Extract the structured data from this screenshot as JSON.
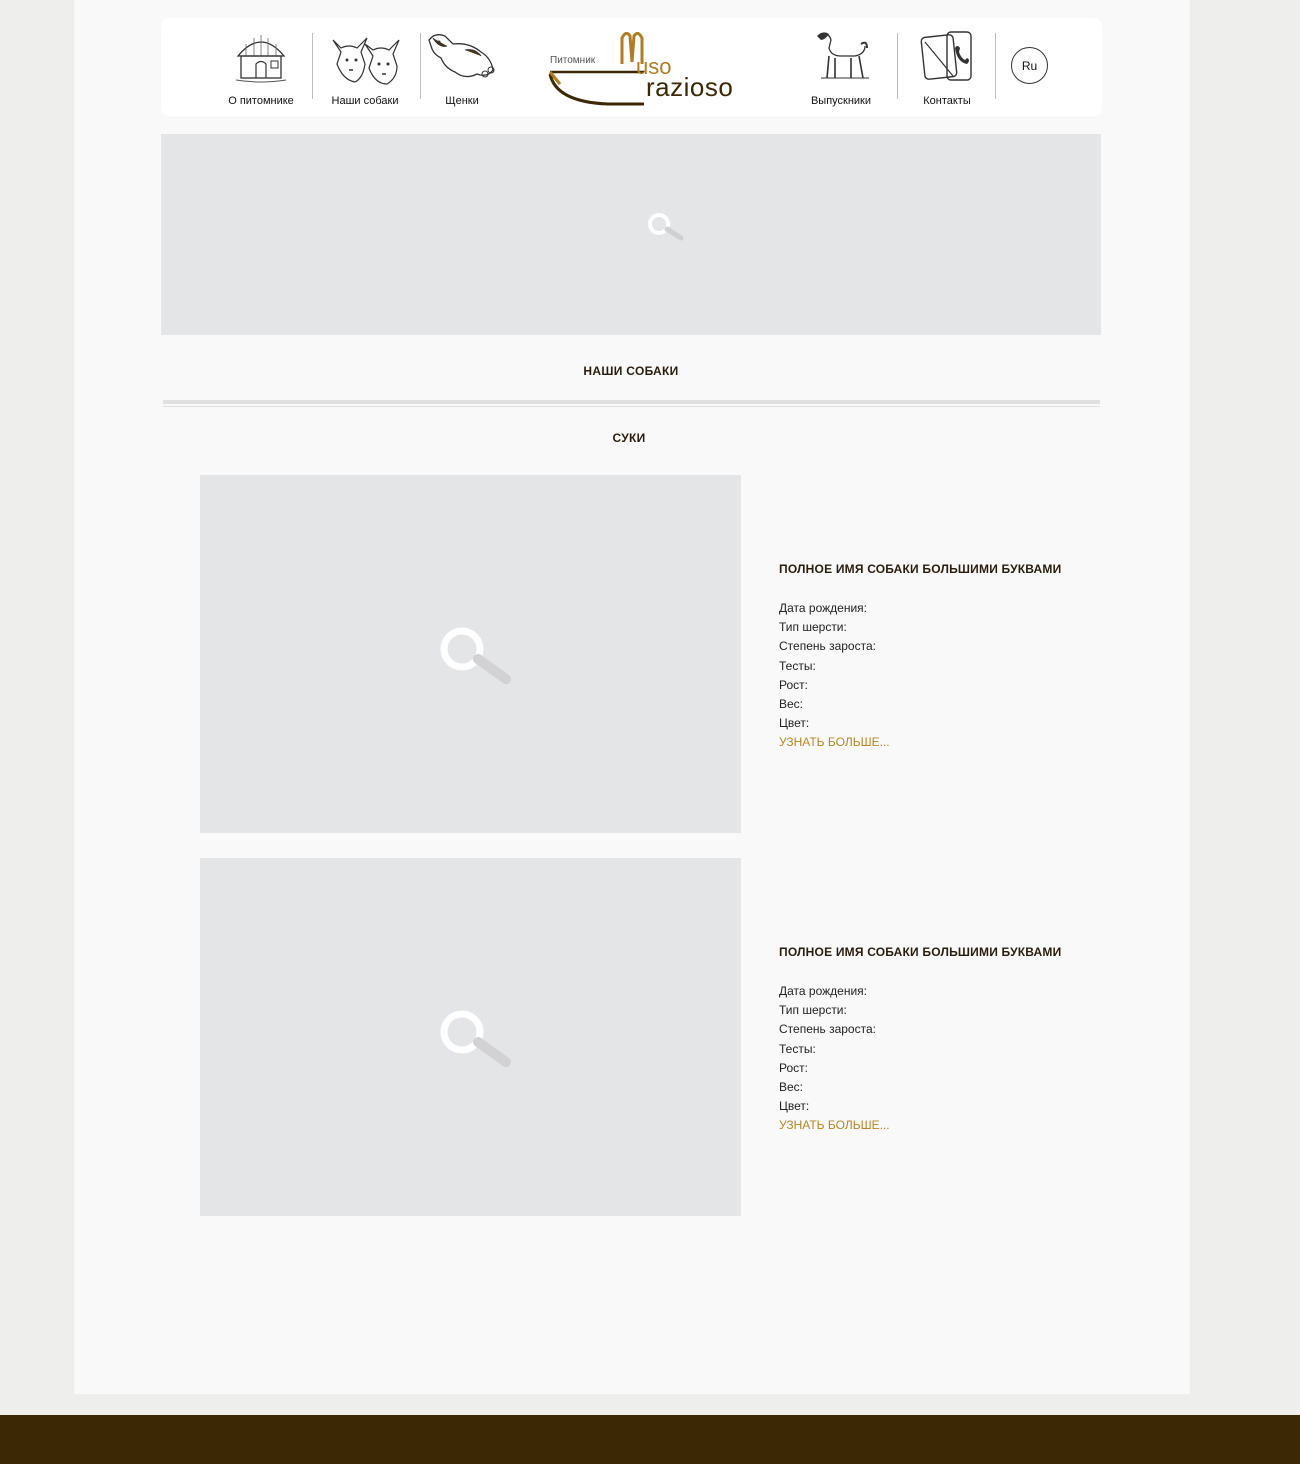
{
  "nav": {
    "items": [
      {
        "label": "О питомнике",
        "icon": "house-icon"
      },
      {
        "label": "Наши собаки",
        "icon": "dogs-icon"
      },
      {
        "label": "Щенки",
        "icon": "puppy-icon"
      },
      {
        "label": "Выпускники",
        "icon": "dog-standing-icon"
      },
      {
        "label": "Контакты",
        "icon": "phone-icon"
      }
    ],
    "lang": "Ru"
  },
  "logo": {
    "subtitle": "Питомник",
    "name_part1": "uso",
    "name_part2": "razioso"
  },
  "banner": {
    "icon": "magnifier-icon"
  },
  "page": {
    "title": "НАШИ СОБАКИ",
    "section": "СУКИ"
  },
  "dogs": [
    {
      "name": "ПОЛНОЕ ИМЯ СОБАКИ БОЛЬШИМИ БУКВАМИ",
      "fields": [
        "Дата рождения:",
        "Тип шерсти:",
        "Степень зароста:",
        "Тесты:",
        "Рост:",
        "Вес:",
        "Цвет:"
      ],
      "more": "УЗНАТЬ БОЛЬШЕ..."
    },
    {
      "name": "ПОЛНОЕ ИМЯ СОБАКИ БОЛЬШИМИ БУКВАМИ",
      "fields": [
        "Дата рождения:",
        "Тип шерсти:",
        "Степень зароста:",
        "Тесты:",
        "Рост:",
        "Вес:",
        "Цвет:"
      ],
      "more": "УЗНАТЬ БОЛЬШЕ..."
    }
  ],
  "colors": {
    "brand_brown": "#3c2804",
    "accent_gold": "#b98523",
    "placeholder_gray": "#e4e5e7"
  }
}
